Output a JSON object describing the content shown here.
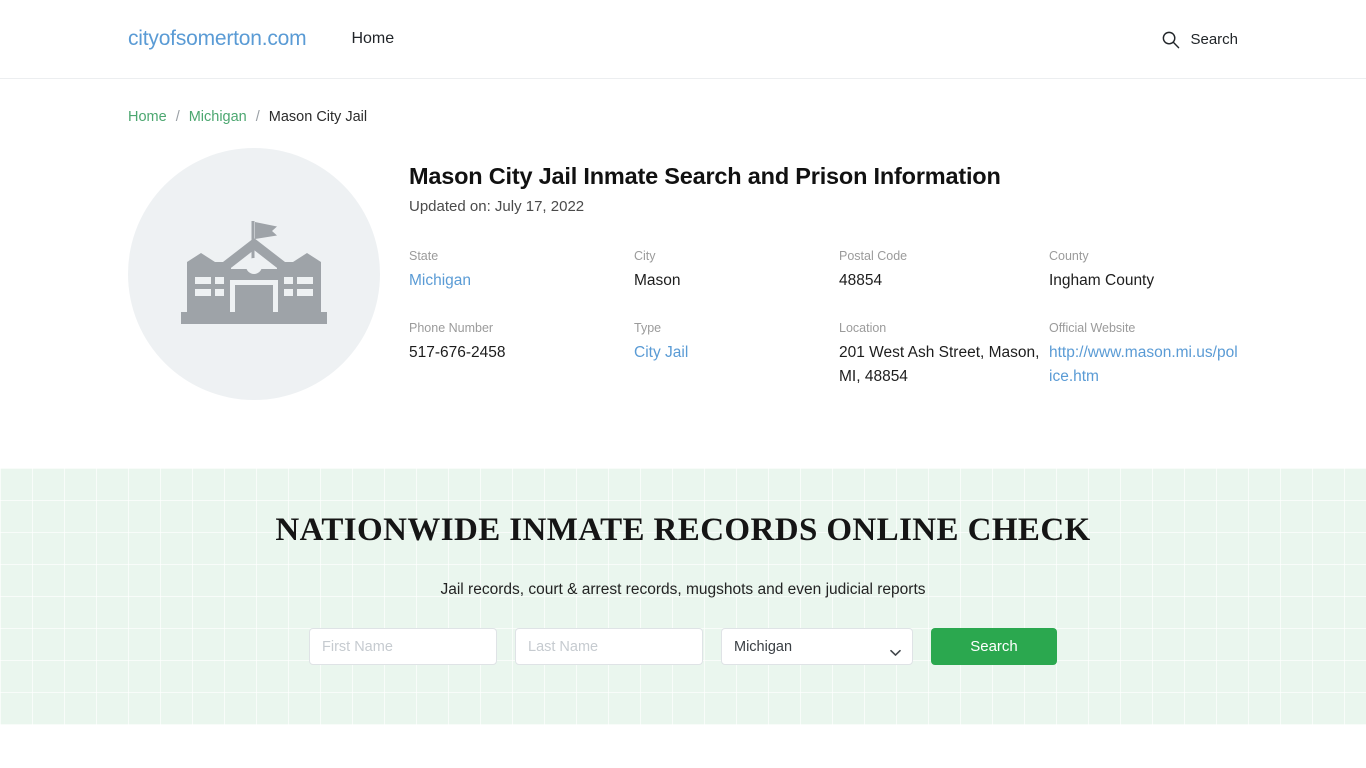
{
  "header": {
    "brand": "cityofsomerton.com",
    "nav": [
      {
        "label": "Home"
      }
    ],
    "search_label": "Search",
    "search_icon": "search-icon"
  },
  "breadcrumb": {
    "items": [
      {
        "label": "Home",
        "link": true
      },
      {
        "label": "Michigan",
        "link": true
      },
      {
        "label": "Mason City Jail",
        "link": false
      }
    ],
    "separator": "/"
  },
  "hero": {
    "figure_icon": "building-icon",
    "title": "Mason City Jail Inmate Search and Prison Information",
    "updated": "Updated on: July 17, 2022",
    "info": [
      {
        "label": "State",
        "value": "Michigan",
        "style": "link"
      },
      {
        "label": "City",
        "value": "Mason",
        "style": "text"
      },
      {
        "label": "Postal Code",
        "value": "48854",
        "style": "text"
      },
      {
        "label": "County",
        "value": "Ingham County",
        "style": "text"
      },
      {
        "label": "Phone Number",
        "value": "517-676-2458",
        "style": "text"
      },
      {
        "label": "Type",
        "value": "City Jail",
        "style": "link"
      },
      {
        "label": "Location",
        "value": "201 West Ash Street, Mason, MI, 48854",
        "style": "text"
      },
      {
        "label": "Official Website",
        "value": "http://www.mason.mi.us/police.htm",
        "style": "link"
      }
    ]
  },
  "promo": {
    "title": "NATIONWIDE INMATE RECORDS ONLINE CHECK",
    "subtitle": "Jail records, court & arrest records, mugshots and even judicial reports",
    "first_name_placeholder": "First Name",
    "first_name_value": "",
    "last_name_placeholder": "Last Name",
    "last_name_value": "",
    "state_selected": "Michigan",
    "state_options": [
      "Michigan"
    ],
    "search_button": "Search",
    "accent_color": "#2ba84f",
    "background_color": "#eaf6ee"
  }
}
